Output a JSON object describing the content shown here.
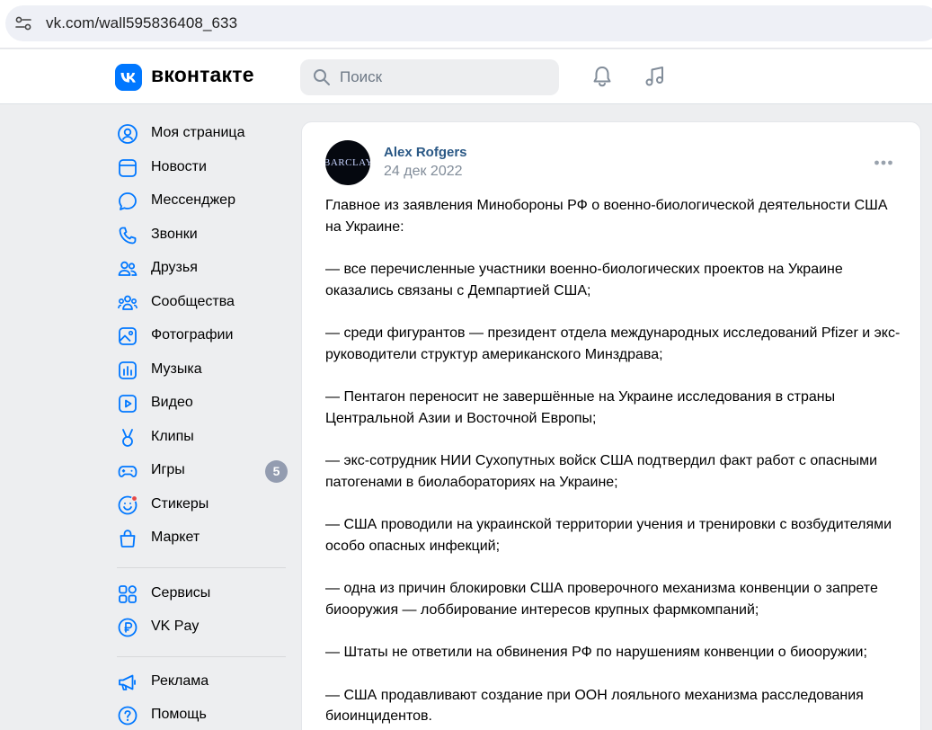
{
  "browser": {
    "url": "vk.com/wall595836408_633",
    "site_info_icon": "site-settings-icon"
  },
  "header": {
    "wordmark": "вконтакте",
    "search_placeholder": "Поиск",
    "icons": [
      "vk-logo-icon",
      "search-icon",
      "bell-icon",
      "music-icon"
    ],
    "accent": "#0077ff"
  },
  "sidebar": {
    "items": [
      {
        "label": "Моя страница",
        "icon": "user-circle-icon"
      },
      {
        "label": "Новости",
        "icon": "news-icon"
      },
      {
        "label": "Мессенджер",
        "icon": "message-icon"
      },
      {
        "label": "Звонки",
        "icon": "phone-icon"
      },
      {
        "label": "Друзья",
        "icon": "friends-icon"
      },
      {
        "label": "Сообщества",
        "icon": "communities-icon"
      },
      {
        "label": "Фотографии",
        "icon": "photos-icon"
      },
      {
        "label": "Музыка",
        "icon": "music-bars-icon"
      },
      {
        "label": "Видео",
        "icon": "video-icon"
      },
      {
        "label": "Клипы",
        "icon": "clips-icon"
      },
      {
        "label": "Игры",
        "icon": "games-icon",
        "badge": "5"
      },
      {
        "label": "Стикеры",
        "icon": "stickers-icon"
      },
      {
        "label": "Маркет",
        "icon": "market-icon"
      }
    ],
    "secondary": [
      {
        "label": "Сервисы",
        "icon": "services-icon"
      },
      {
        "label": "VK Pay",
        "icon": "vkpay-icon"
      }
    ],
    "tertiary": [
      {
        "label": "Реклама",
        "icon": "megaphone-icon"
      },
      {
        "label": "Помощь",
        "icon": "help-icon"
      }
    ]
  },
  "post": {
    "author": "Alex Rofgers",
    "date": "24 дек 2022",
    "avatar_text": "BARCLAY",
    "paragraphs": [
      "Главное из заявления Минобороны РФ о военно-биологической деятельности США на Украине:",
      "— все перечисленные участники военно-биологических проектов на Украине оказались связаны с Демпартией США;",
      "— среди фигурантов — президент отдела международных исследований Pfizer и экс-руководители структур американского Минздрава;",
      "— Пентагон переносит не завершённые на Украине исследования в страны Центральной Азии и Восточной Европы;",
      "— экс-сотрудник НИИ Сухопутных войск США подтвердил факт работ с опасными патогенами в биолабораториях на Украине;",
      "— США проводили на украинской территории учения и тренировки с возбудителями особо опасных инфекций;",
      "— одна из причин блокировки США проверочного механизма конвенции о запрете биооружия — лоббирование интересов крупных фармкомпаний;",
      "— Штаты не ответили на обвинения РФ по нарушениям конвенции о биооружии;",
      "— США продавливают создание при ООН лояльного механизма расследования биоинцидентов."
    ]
  }
}
